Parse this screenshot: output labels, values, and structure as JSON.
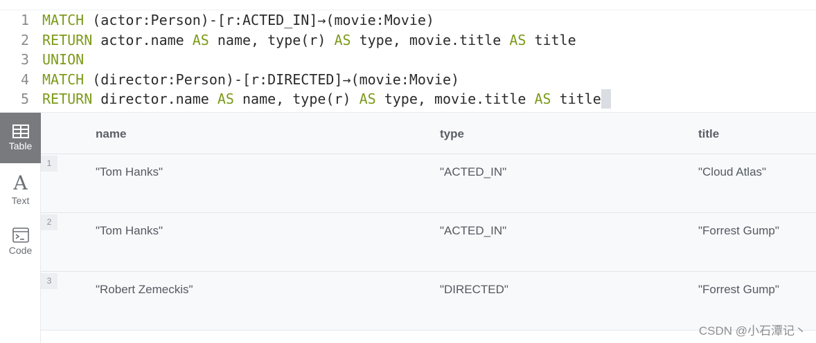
{
  "editor": {
    "lines": [
      {
        "num": "1",
        "tokens": [
          {
            "t": "MATCH",
            "kw": true
          },
          {
            "t": " (actor:Person)-[r:ACTED_IN]→(movie:Movie)",
            "kw": false
          }
        ]
      },
      {
        "num": "2",
        "tokens": [
          {
            "t": "RETURN",
            "kw": true
          },
          {
            "t": " actor.name ",
            "kw": false
          },
          {
            "t": "AS",
            "kw": true
          },
          {
            "t": " name, type(r) ",
            "kw": false
          },
          {
            "t": "AS",
            "kw": true
          },
          {
            "t": " type, movie.title ",
            "kw": false
          },
          {
            "t": "AS",
            "kw": true
          },
          {
            "t": " title",
            "kw": false
          }
        ]
      },
      {
        "num": "3",
        "tokens": [
          {
            "t": "UNION",
            "kw": true
          }
        ]
      },
      {
        "num": "4",
        "tokens": [
          {
            "t": "MATCH",
            "kw": true
          },
          {
            "t": " (director:Person)-[r:DIRECTED]→(movie:Movie)",
            "kw": false
          }
        ]
      },
      {
        "num": "5",
        "tokens": [
          {
            "t": "RETURN",
            "kw": true
          },
          {
            "t": " director.name ",
            "kw": false
          },
          {
            "t": "AS",
            "kw": true
          },
          {
            "t": " name, type(r) ",
            "kw": false
          },
          {
            "t": "AS",
            "kw": true
          },
          {
            "t": " type, movie.title ",
            "kw": false
          },
          {
            "t": "AS",
            "kw": true
          },
          {
            "t": " title",
            "kw": false
          }
        ]
      }
    ]
  },
  "views": {
    "table": "Table",
    "text": "Text",
    "code": "Code",
    "active": "table"
  },
  "table": {
    "columns": [
      "name",
      "type",
      "title"
    ],
    "rows": [
      {
        "num": "1",
        "name": "\"Tom Hanks\"",
        "type": "\"ACTED_IN\"",
        "title": "\"Cloud Atlas\""
      },
      {
        "num": "2",
        "name": "\"Tom Hanks\"",
        "type": "\"ACTED_IN\"",
        "title": "\"Forrest Gump\""
      },
      {
        "num": "3",
        "name": "\"Robert Zemeckis\"",
        "type": "\"DIRECTED\"",
        "title": "\"Forrest Gump\""
      }
    ]
  },
  "watermark": "CSDN @小石潭记丶",
  "colors": {
    "keyword": "#7c9a1a",
    "active_view": "#787a7e"
  }
}
